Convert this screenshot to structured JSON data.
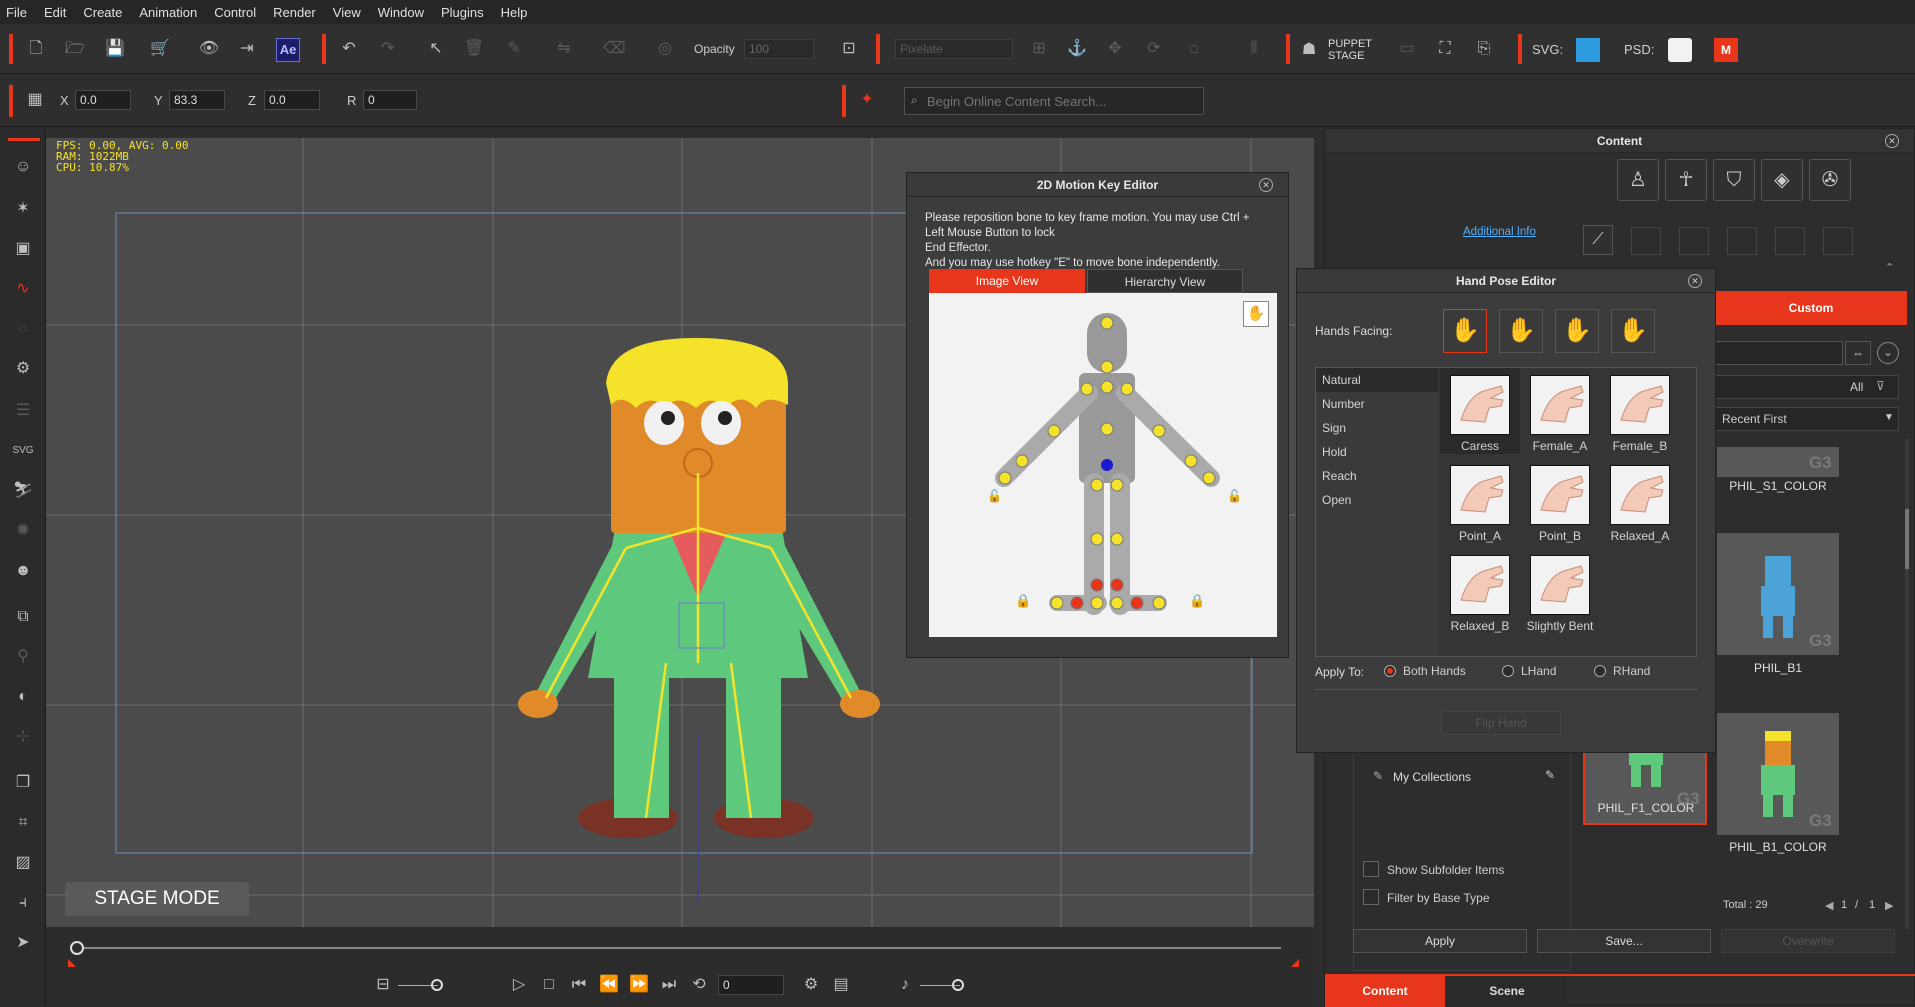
{
  "menu": [
    "File",
    "Edit",
    "Create",
    "Animation",
    "Control",
    "Render",
    "View",
    "Window",
    "Plugins",
    "Help"
  ],
  "toolbar": {
    "opacity_label": "Opacity",
    "opacity_value": "100",
    "pixelate": "Pixelate",
    "puppet_stage": [
      "PUPPET",
      "STAGE"
    ],
    "svg_label": "SVG:",
    "psd_label": "PSD:",
    "ae": "Ae"
  },
  "transform": {
    "x_label": "X",
    "x": "0.0",
    "y_label": "Y",
    "y": "83.3",
    "z_label": "Z",
    "z": "0.0",
    "r_label": "R",
    "r": "0"
  },
  "search": {
    "placeholder": "Begin Online Content Search..."
  },
  "stats": {
    "fps": "FPS: 0.00, AVG: 0.00",
    "ram": "RAM: 1022MB",
    "cpu": "CPU: 10.87%"
  },
  "stage_mode": "STAGE MODE",
  "frame": "0",
  "motion_editor": {
    "title": "2D Motion Key Editor",
    "instructions": [
      "Please reposition bone to key frame motion. You may use Ctrl + Left Mouse Button to lock",
      "End Effector.",
      "And you may use hotkey \"E\" to move bone independently."
    ],
    "info_link": "Additional Info",
    "tabs": [
      "Image View",
      "Hierarchy View"
    ]
  },
  "hand_pose": {
    "title": "Hand Pose Editor",
    "facing_label": "Hands Facing:",
    "categories": [
      "Natural",
      "Number",
      "Sign",
      "Hold",
      "Reach",
      "Open"
    ],
    "poses": [
      "Caress",
      "Female_A",
      "Female_B",
      "Point_A",
      "Point_B",
      "Relaxed_A",
      "Relaxed_B",
      "Slightly Bent"
    ],
    "apply_to_label": "Apply To:",
    "options": [
      "Both Hands",
      "LHand",
      "RHand"
    ],
    "flip": "Flip Hand"
  },
  "content": {
    "title": "Content",
    "custom_tab": "Custom",
    "filter": "All",
    "sort": "Recent First",
    "items": [
      "PHIL_S1_COLOR",
      "PHIL_B1",
      "PHIL_F1_COLOR",
      "PHIL_B1_COLOR"
    ],
    "g3": "G3",
    "collections": "My Collections",
    "show_subfolder": "Show Subfolder Items",
    "filter_base": "Filter by Base Type",
    "total": "Total : 29",
    "page": "1",
    "pages": "1",
    "page_sep": "/",
    "apply": "Apply",
    "save": "Save...",
    "overwrite": "Overwrite",
    "bottom_tabs": [
      "Content",
      "Scene"
    ]
  },
  "colors": {
    "accent": "#e8361c",
    "character_skin": "#e08a2a",
    "suit": "#5ec97d",
    "hair": "#f5e22a"
  }
}
